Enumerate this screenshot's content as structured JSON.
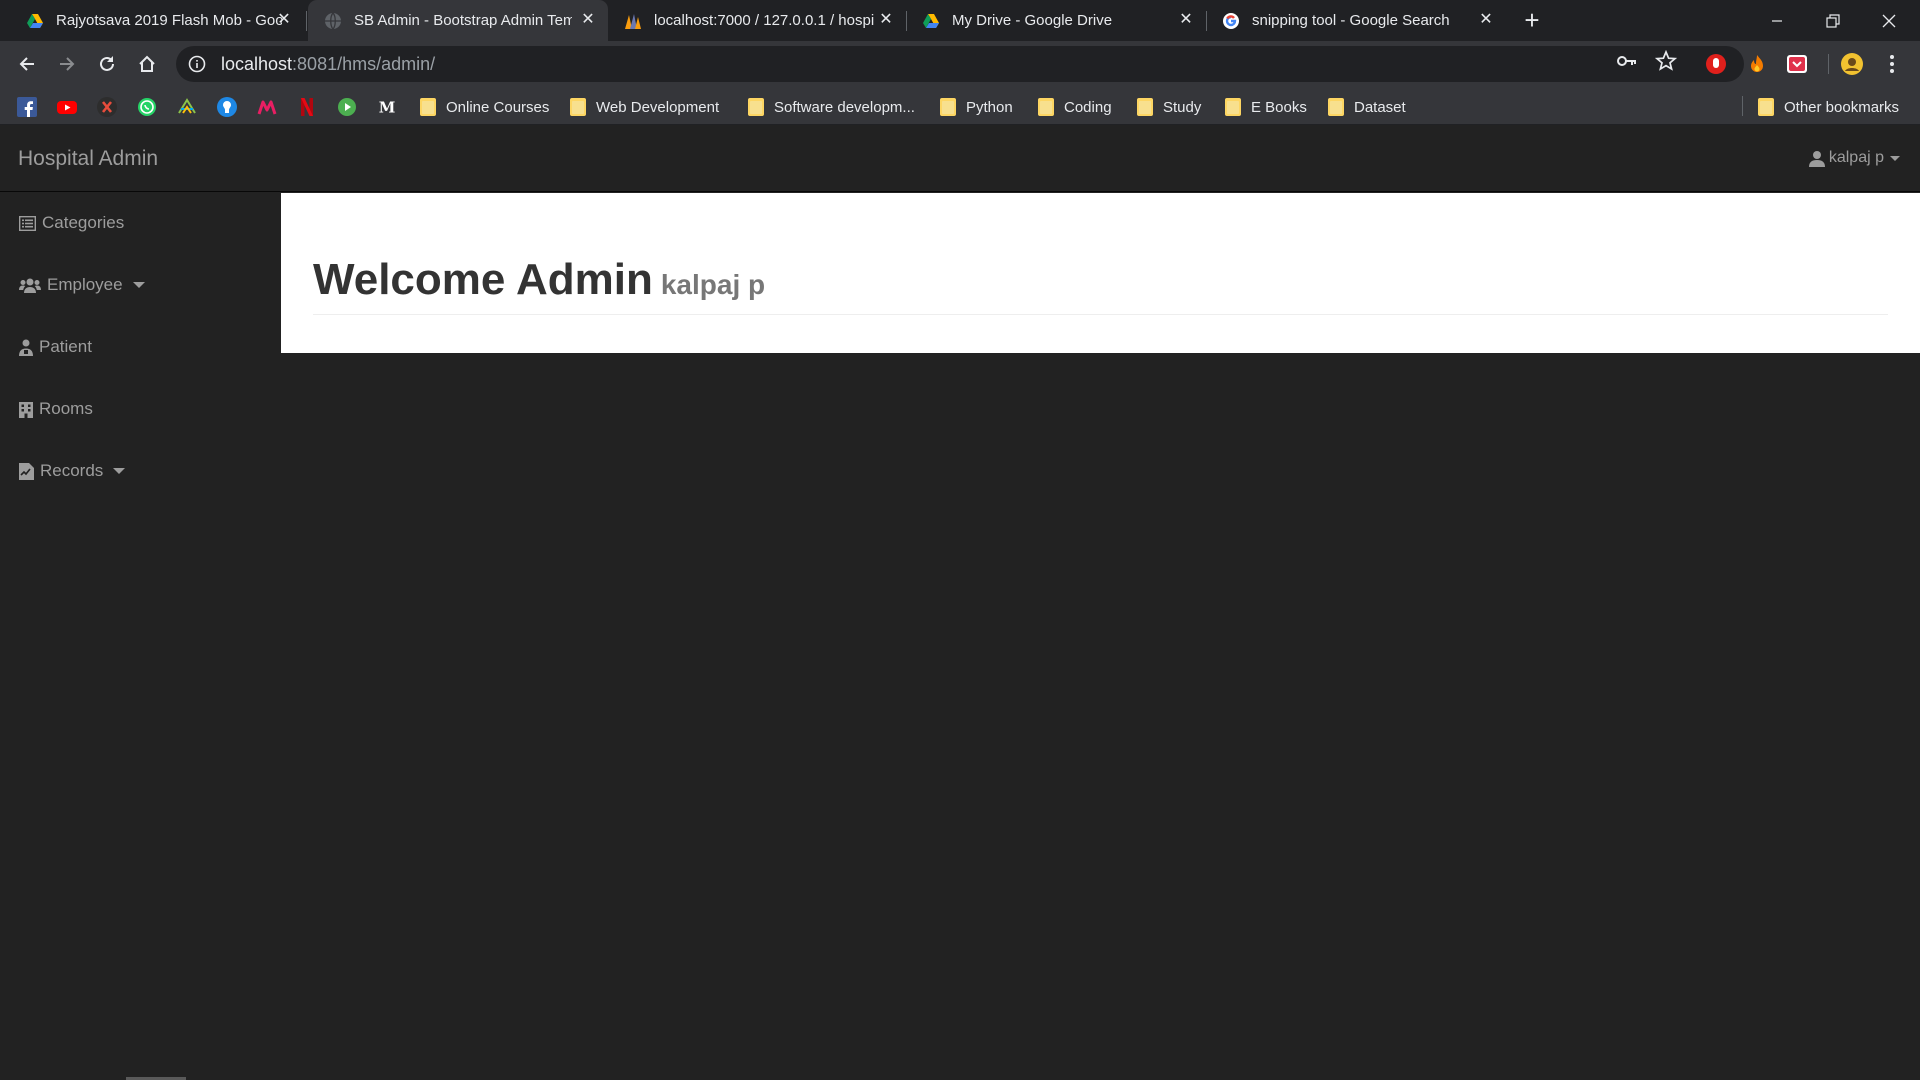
{
  "browser": {
    "tabs": [
      {
        "title": "Rajyotsava 2019 Flash Mob - Goo",
        "icon": "google-drive-icon",
        "active": false
      },
      {
        "title": "SB Admin - Bootstrap Admin Tem",
        "icon": "globe-icon",
        "active": true
      },
      {
        "title": "localhost:7000 / 127.0.0.1 / hospi",
        "icon": "phpmyadmin-icon",
        "active": false
      },
      {
        "title": "My Drive - Google Drive",
        "icon": "google-drive-icon",
        "active": false
      },
      {
        "title": "snipping tool - Google Search",
        "icon": "google-icon",
        "active": false
      }
    ],
    "url_host": "localhost",
    "url_rest": ":8081/hms/admin/",
    "bookmark_icons": [
      "facebook-icon",
      "youtube-icon",
      "x-icon",
      "whatsapp-icon",
      "feedly-icon",
      "app-icon",
      "meesho-icon",
      "netflix-icon",
      "play-icon",
      "medium-icon"
    ],
    "bookmark_folders": [
      {
        "label": "Online Courses"
      },
      {
        "label": "Web Development"
      },
      {
        "label": "Software developm..."
      },
      {
        "label": "Python"
      },
      {
        "label": "Coding"
      },
      {
        "label": "Study"
      },
      {
        "label": "E Books"
      },
      {
        "label": "Dataset"
      }
    ],
    "other_bookmarks": "Other bookmarks"
  },
  "app": {
    "brand": "Hospital Admin",
    "user": "kalpaj p",
    "sidebar": [
      {
        "label": "Categories",
        "icon": "list-icon",
        "dropdown": false
      },
      {
        "label": "Employee",
        "icon": "users-icon",
        "dropdown": true
      },
      {
        "label": "Patient",
        "icon": "patient-icon",
        "dropdown": false
      },
      {
        "label": "Rooms",
        "icon": "building-icon",
        "dropdown": false
      },
      {
        "label": "Records",
        "icon": "records-icon",
        "dropdown": true
      }
    ],
    "welcome_title": "Welcome Admin",
    "welcome_sub": "kalpaj p"
  },
  "colors": {
    "navbar_bg": "#222222",
    "nav_text": "#9d9d9d",
    "content_bg": "#ffffff",
    "title_text": "#333333"
  }
}
